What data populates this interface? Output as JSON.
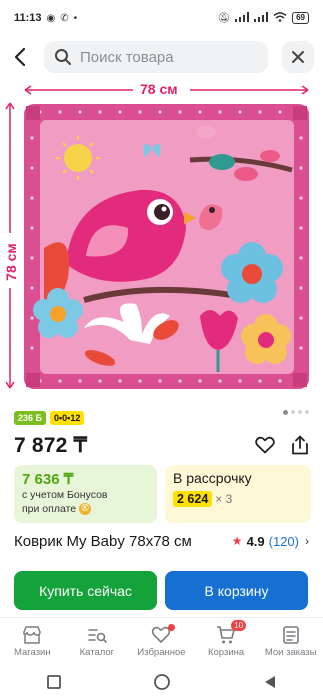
{
  "status_bar": {
    "time": "11:13",
    "battery": "69"
  },
  "search": {
    "placeholder": "Поиск товара"
  },
  "image": {
    "width_label": "78 см",
    "height_label": "78 см"
  },
  "badges": {
    "bonus": "236 Б",
    "installment": "0•0•12"
  },
  "price": {
    "main": "7 872 ₸"
  },
  "bonus_card": {
    "amount": "7 636 ₸",
    "line1": "с учетом Бонусов",
    "line2": "при оплате"
  },
  "installment_card": {
    "title": "В рассрочку",
    "amount": "2 624",
    "multiplier": "× 3"
  },
  "product": {
    "title": "Коврик My Baby 78x78 см"
  },
  "rating": {
    "value": "4.9",
    "reviews": "(120)"
  },
  "actions": {
    "buy_now": "Купить сейчас",
    "add_to_cart": "В корзину"
  },
  "tabs": [
    {
      "label": "Магазин",
      "icon": "store-icon"
    },
    {
      "label": "Каталог",
      "icon": "catalog-icon"
    },
    {
      "label": "Избранное",
      "icon": "heart-icon"
    },
    {
      "label": "Корзина",
      "icon": "cart-icon",
      "badge": "10"
    },
    {
      "label": "Мои заказы",
      "icon": "orders-icon"
    }
  ],
  "colors": {
    "accent_green": "#13a33a",
    "accent_blue": "#1570d2",
    "bonus_green": "#52a60f",
    "installment_yellow": "#ffe000"
  }
}
